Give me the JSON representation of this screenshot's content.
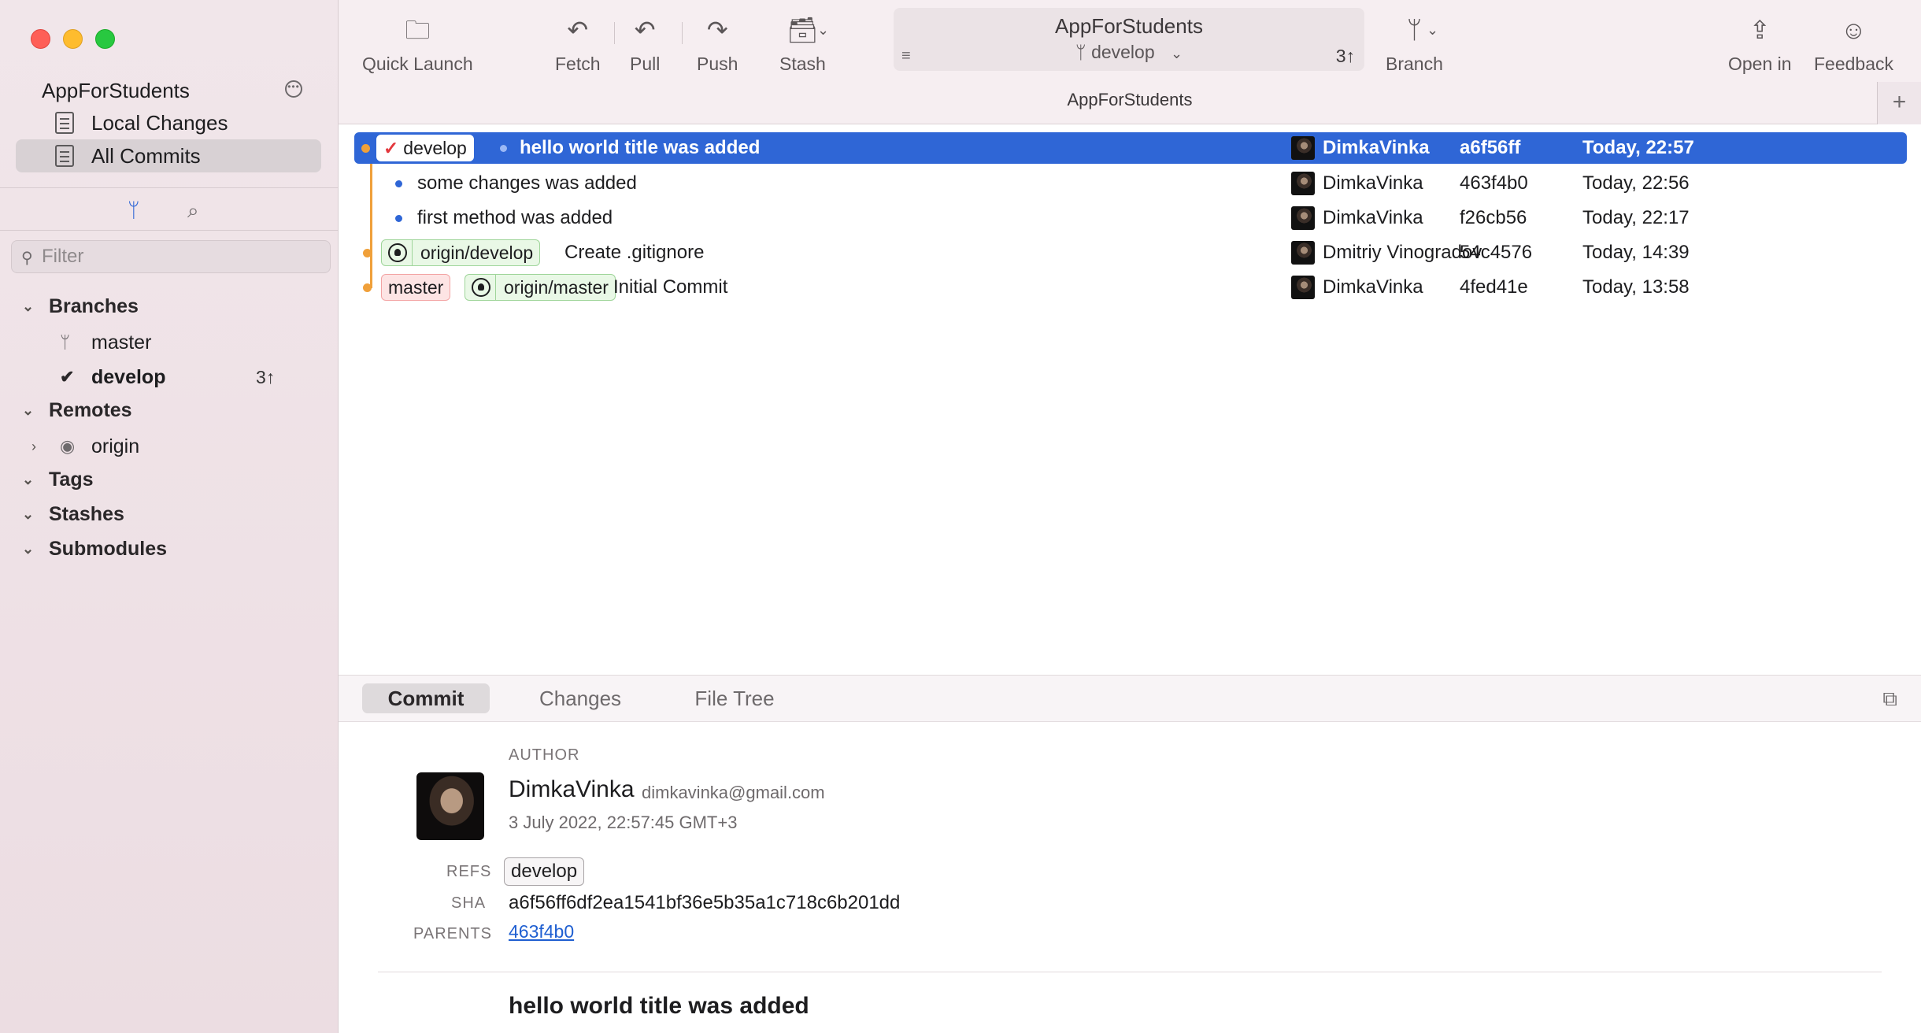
{
  "sidebar": {
    "repo_name": "AppForStudents",
    "nav": [
      {
        "label": "Local Changes"
      },
      {
        "label": "All Commits"
      }
    ],
    "filter_placeholder": "Filter",
    "sections": {
      "branches": "Branches",
      "remotes": "Remotes",
      "tags": "Tags",
      "stashes": "Stashes",
      "submodules": "Submodules"
    },
    "branches": [
      {
        "name": "master",
        "ahead": ""
      },
      {
        "name": "develop",
        "ahead": "3↑"
      }
    ],
    "remotes": [
      {
        "name": "origin"
      }
    ]
  },
  "toolbar": {
    "buttons": {
      "quick_launch": "Quick Launch",
      "fetch": "Fetch",
      "pull": "Pull",
      "push": "Push",
      "stash": "Stash",
      "branch": "Branch",
      "open_in": "Open in",
      "feedback": "Feedback"
    },
    "repo_title": "AppForStudents",
    "current_branch": "develop",
    "ahead": "3↑",
    "window_tab": "AppForStudents"
  },
  "commits": [
    {
      "refs": [
        {
          "type": "local",
          "name": "develop",
          "checked": true
        }
      ],
      "message": "hello world title was added",
      "author": "DimkaVinka",
      "sha": "a6f56ff",
      "date": "Today, 22:57",
      "selected": true
    },
    {
      "refs": [],
      "message": "some changes was added",
      "author": "DimkaVinka",
      "sha": "463f4b0",
      "date": "Today, 22:56"
    },
    {
      "refs": [],
      "message": "first method was added",
      "author": "DimkaVinka",
      "sha": "f26cb56",
      "date": "Today, 22:17"
    },
    {
      "refs": [
        {
          "type": "remote",
          "name": "origin/develop"
        }
      ],
      "message": "Create .gitignore",
      "author": "Dmitriy Vinogradov",
      "sha": "54c4576",
      "date": "Today, 14:39"
    },
    {
      "refs": [
        {
          "type": "local",
          "name": "master"
        },
        {
          "type": "remote",
          "name": "origin/master"
        }
      ],
      "message": "Initial Commit",
      "author": "DimkaVinka",
      "sha": "4fed41e",
      "date": "Today, 13:58"
    }
  ],
  "detail": {
    "tabs": [
      "Commit",
      "Changes",
      "File Tree"
    ],
    "labels": {
      "author": "AUTHOR",
      "refs": "REFS",
      "sha": "SHA",
      "parents": "PARENTS"
    },
    "author_name": "DimkaVinka",
    "author_email": "dimkavinka@gmail.com",
    "date": "3 July 2022, 22:57:45 GMT+3",
    "ref": "develop",
    "sha_full": "a6f56ff6df2ea1541bf36e5b35a1c718c6b201dd",
    "parent": "463f4b0",
    "message": "hello world title was added"
  },
  "colors": {
    "selection": "#2f66d6",
    "graph": "#f0a03a",
    "local_ref_bg": "#fde4e4",
    "remote_ref_bg": "#e9f8e6"
  }
}
